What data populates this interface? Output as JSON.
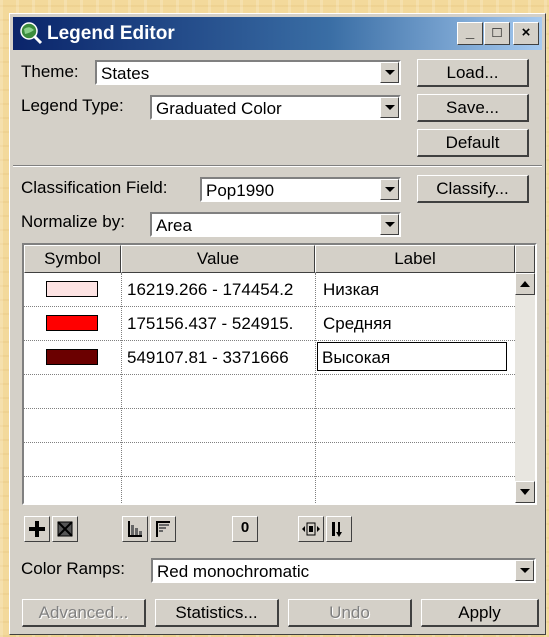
{
  "window": {
    "title": "Legend Editor",
    "icon": "globe-magnifier-icon"
  },
  "title_controls": {
    "minimize": "_",
    "maximize": "□",
    "close": "×"
  },
  "theme": {
    "label": "Theme:",
    "value": "States"
  },
  "legend_type": {
    "label": "Legend Type:",
    "value": "Graduated Color"
  },
  "buttons": {
    "load": "Load...",
    "save": "Save...",
    "default": "Default",
    "classify": "Classify..."
  },
  "classification": {
    "field_label": "Classification Field:",
    "field_value": "Pop1990",
    "normalize_label": "Normalize by:",
    "normalize_value": "Area"
  },
  "table": {
    "headers": [
      "Symbol",
      "Value",
      "Label"
    ],
    "rows": [
      {
        "color": "#fde3e3",
        "value": "16219.266 - 174454.2",
        "label": "Низкая"
      },
      {
        "color": "#ff0000",
        "value": "175156.437 - 524915.",
        "label": "Средняя"
      },
      {
        "color": "#6b0000",
        "value": "549107.81 - 3371666",
        "label": "Высокая"
      }
    ],
    "empty_rows": 4
  },
  "tools": [
    "add-class-icon",
    "delete-class-icon",
    "ramp-up-icon",
    "ramp-down-icon",
    "null-value-icon",
    "reverse-icon",
    "sort-icon"
  ],
  "tool_glyphs": {
    "null": "0"
  },
  "color_ramps": {
    "label": "Color Ramps:",
    "value": "Red monochromatic"
  },
  "bottom_buttons": {
    "advanced": "Advanced...",
    "statistics": "Statistics...",
    "undo": "Undo",
    "apply": "Apply"
  }
}
